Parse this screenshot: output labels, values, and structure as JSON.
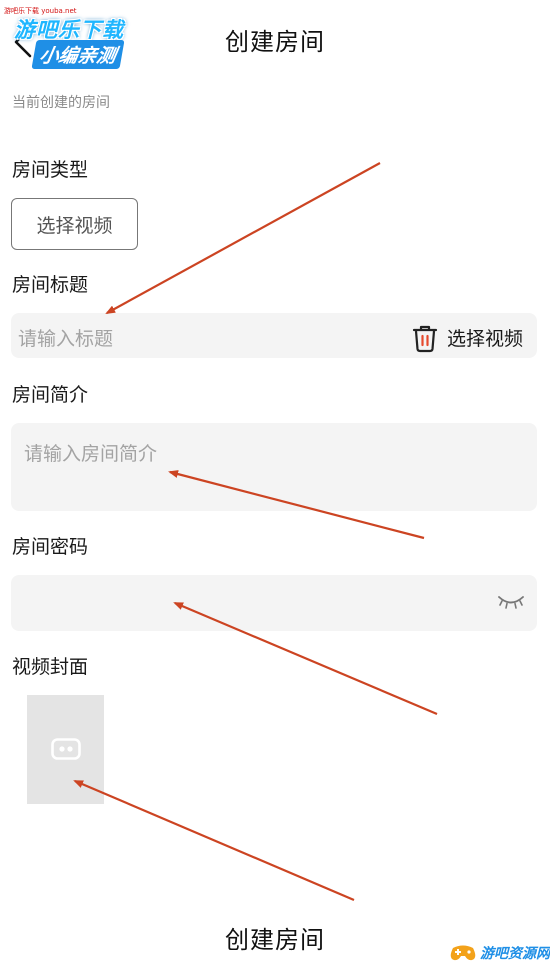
{
  "header": {
    "title": "创建房间"
  },
  "watermark": {
    "top_small": "游吧乐下载 youba.net",
    "line1": "游吧乐下载",
    "line2": "小编亲测",
    "bottom_right": "游吧资源网"
  },
  "form": {
    "section_hint": "当前创建的房间",
    "room_type": {
      "label": "房间类型",
      "button_label": "选择视频"
    },
    "room_title": {
      "label": "房间标题",
      "placeholder": "请输入标题",
      "select_video_label": "选择视频"
    },
    "room_intro": {
      "label": "房间简介",
      "placeholder": "请输入房间简介"
    },
    "room_password": {
      "label": "房间密码",
      "placeholder": ""
    },
    "video_cover": {
      "label": "视频封面"
    }
  },
  "footer": {
    "create_label": "创建房间"
  },
  "colors": {
    "arrow": "#cc4422",
    "field_bg": "#f4f4f4",
    "placeholder": "#a3a3a3",
    "accent_blue": "#1f8fe6",
    "trash_accent": "#e64a2e"
  },
  "icons": [
    "back-arrow-icon",
    "trash-icon",
    "eye-closed-icon",
    "video-icon"
  ]
}
